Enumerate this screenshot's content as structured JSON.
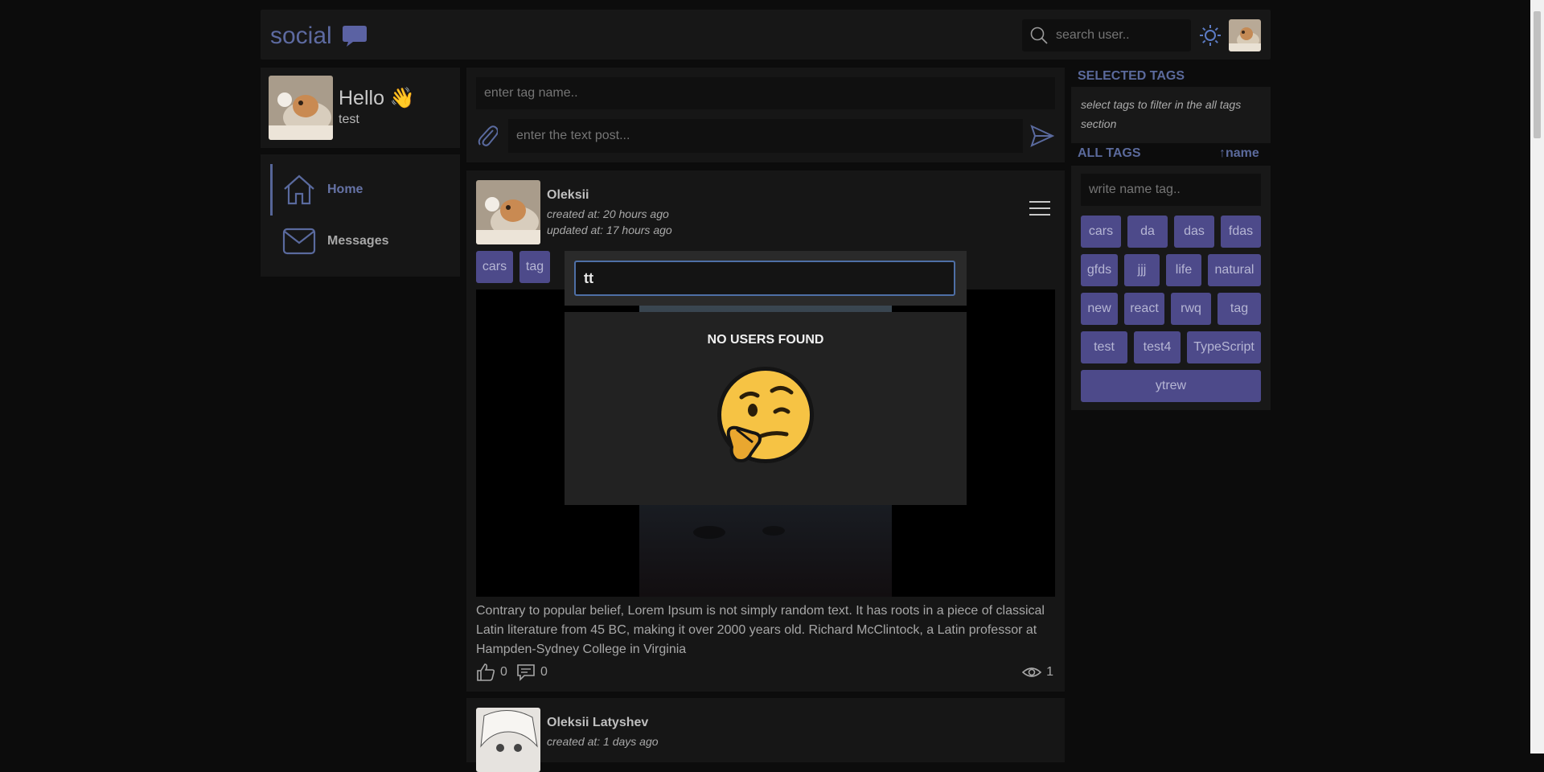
{
  "header": {
    "logo_text": "social",
    "logo_icon": "chat-bubble-icon",
    "search_placeholder": "search user..",
    "theme_icon": "sun-icon"
  },
  "profile": {
    "greeting": "Hello 👋",
    "username": "test"
  },
  "nav": {
    "items": [
      {
        "label": "Home",
        "icon": "home-icon",
        "active": true
      },
      {
        "label": "Messages",
        "icon": "envelope-icon",
        "active": false
      }
    ]
  },
  "composer": {
    "tag_placeholder": "enter tag name..",
    "post_placeholder": "enter the text post..."
  },
  "posts": [
    {
      "author": "Oleksii",
      "created": "created at: 20 hours ago",
      "updated": "updated at: 17 hours ago",
      "tags": [
        "cars",
        "tag"
      ],
      "text": "Contrary to popular belief, Lorem Ipsum is not simply random text. It has roots in a piece of classical Latin literature from 45 BC, making it over 2000 years old. Richard McClintock, a Latin professor at Hampden-Sydney College in Virginia",
      "likes": "0",
      "comments": "0",
      "views": "1"
    },
    {
      "author": "Oleksii Latyshev",
      "created": "created at: 1 days ago"
    }
  ],
  "selected_tags": {
    "title": "SELECTED TAGS",
    "hint": "select tags to filter in the all tags section"
  },
  "all_tags": {
    "title": "ALL TAGS",
    "sort_label": "↑name",
    "filter_placeholder": "write name tag..",
    "tags": [
      "cars",
      "da",
      "das",
      "fdas",
      "gfds",
      "jjj",
      "life",
      "natural",
      "new",
      "react",
      "rwq",
      "tag",
      "test",
      "test4",
      "TypeScript",
      "ytrew"
    ]
  },
  "user_search": {
    "query": "tt",
    "empty_message": "NO USERS FOUND",
    "emoji_icon": "thinking-face-icon"
  },
  "colors": {
    "accent": "#5a6a9e",
    "tag_chip": "#4d4a8a",
    "background": "#0c0c0c",
    "panel": "#161616",
    "input_focus": "#4e6fa6"
  }
}
